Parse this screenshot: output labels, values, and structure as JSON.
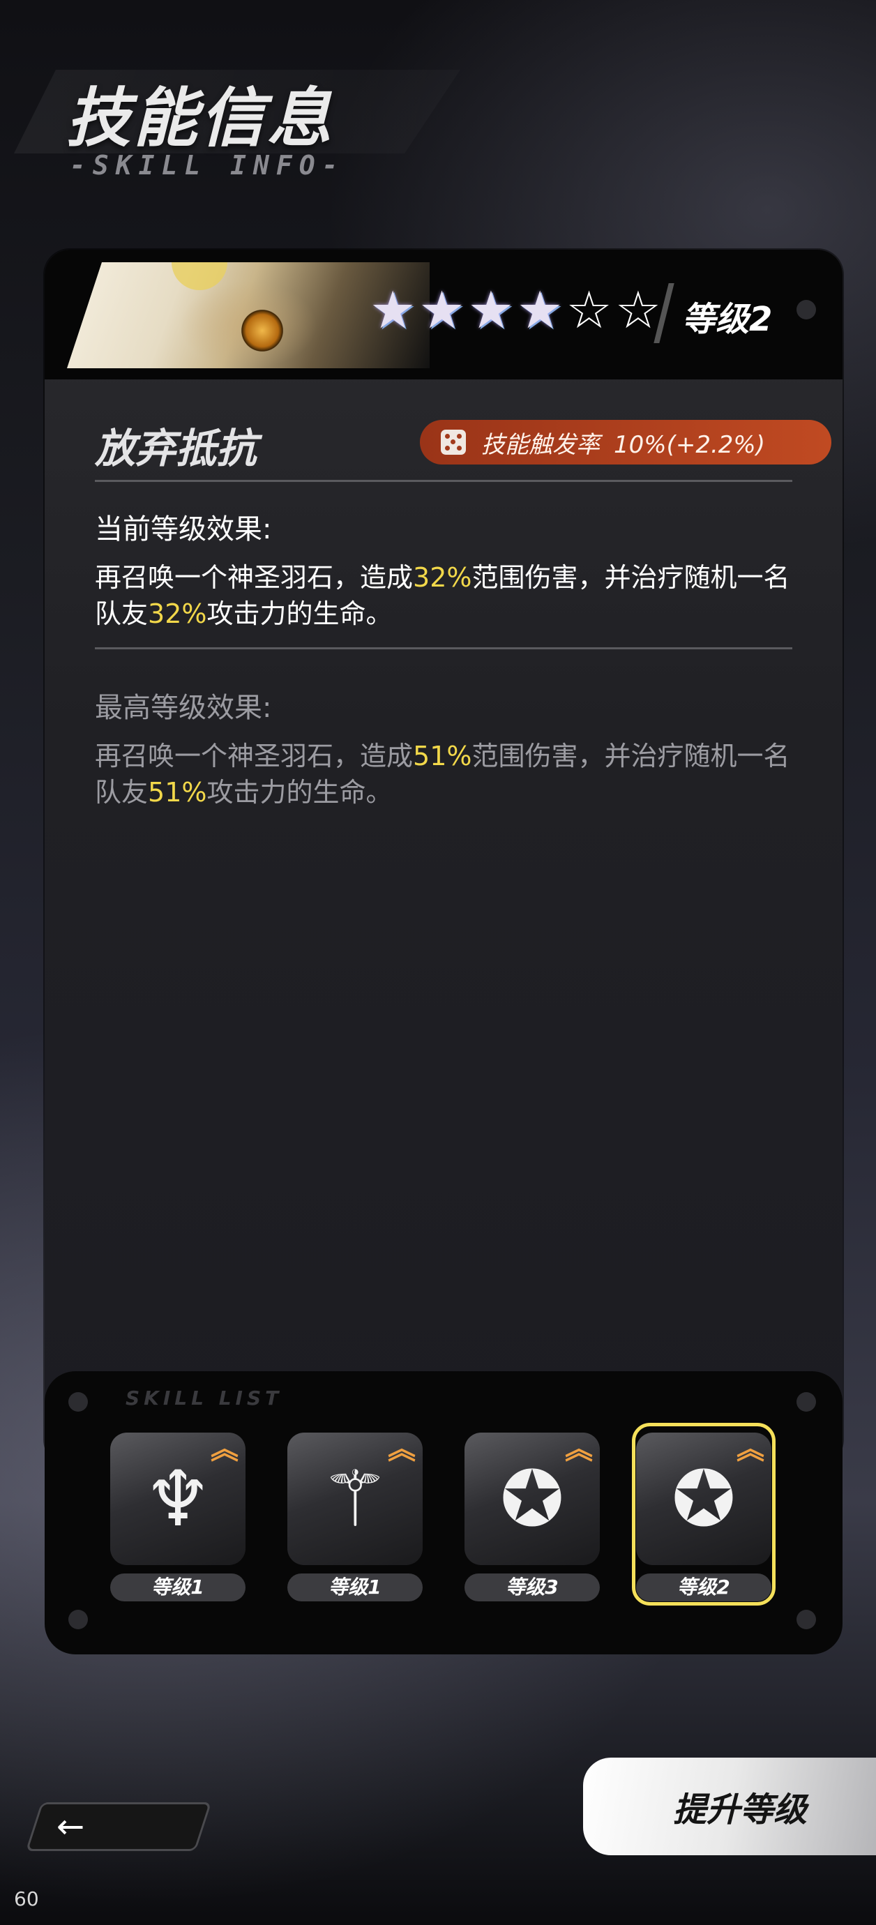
{
  "header": {
    "title": "技能信息",
    "subtitle": "-SKILL INFO-"
  },
  "skill_card": {
    "stars": [
      "filled",
      "filled",
      "filled",
      "filled",
      "empty",
      "empty"
    ],
    "level_label": "等级2",
    "skill_name": "放弃抵抗",
    "trigger": {
      "label": "技能触发率",
      "value": "10%(+2.2%)"
    },
    "current": {
      "title": "当前等级效果:",
      "text_parts": [
        "再召唤一个神圣羽石，造成",
        "32%",
        "范围伤害，并治疗随机一名队友",
        "32%",
        "攻击力的生命。"
      ]
    },
    "max": {
      "title": "最高等级效果:",
      "text_parts": [
        "再召唤一个神圣羽石，造成",
        "51%",
        "范围伤害，并治疗随机一名队友",
        "51%",
        "攻击力的生命。"
      ]
    }
  },
  "skill_list": {
    "label": "SKILL LIST",
    "slots": [
      {
        "icon": "dragon-crest-icon",
        "level": "等级1",
        "upgrade": true,
        "selected": false
      },
      {
        "icon": "feather-slash-icon",
        "level": "等级1",
        "upgrade": true,
        "selected": false
      },
      {
        "icon": "compass-star-icon",
        "level": "等级3",
        "upgrade": true,
        "selected": false
      },
      {
        "icon": "compass-star-icon",
        "level": "等级2",
        "upgrade": true,
        "selected": true
      }
    ]
  },
  "actions": {
    "upgrade_label": "提升等级",
    "back_icon": "arrow-left-icon"
  },
  "fps": "60",
  "colors": {
    "highlight": "#f2d84a",
    "trigger_pill": "#b0401e",
    "selected_border": "#f5e05a",
    "upgrade_arrow": "#f0a040"
  }
}
